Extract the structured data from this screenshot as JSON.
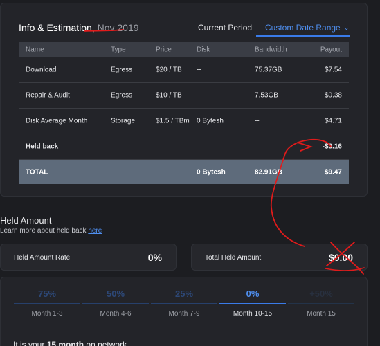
{
  "info": {
    "title": "Info & Estimation,",
    "period": "Nov 2019",
    "tabs": {
      "current": "Current Period",
      "custom": "Custom Date Range"
    },
    "table": {
      "headers": {
        "name": "Name",
        "type": "Type",
        "price": "Price",
        "disk": "Disk",
        "bandwidth": "Bandwidth",
        "payout": "Payout"
      },
      "rows": [
        {
          "name": "Download",
          "type": "Egress",
          "price": "$20 / TB",
          "disk": "--",
          "bandwidth": "75.37GB",
          "payout": "$7.54"
        },
        {
          "name": "Repair & Audit",
          "type": "Egress",
          "price": "$10 / TB",
          "disk": "--",
          "bandwidth": "7.53GB",
          "payout": "$0.38"
        },
        {
          "name": "Disk Average Month",
          "type": "Storage",
          "price": "$1.5 / TBm",
          "disk": "0 Bytesh",
          "bandwidth": "--",
          "payout": "$4.71"
        }
      ],
      "held_back": {
        "name": "Held back",
        "payout": "-$3.16"
      },
      "total": {
        "name": "TOTAL",
        "disk": "0 Bytesh",
        "bandwidth": "82.91GB",
        "payout": "$9.47"
      }
    }
  },
  "held": {
    "title": "Held Amount",
    "subtitle": "Learn more about held back",
    "link": "here",
    "rate_label": "Held Amount Rate",
    "rate_value": "0%",
    "total_label": "Total Held Amount",
    "total_value": "$0.00"
  },
  "months": [
    {
      "pct": "75%",
      "label": "Month 1-3"
    },
    {
      "pct": "50%",
      "label": "Month 4-6"
    },
    {
      "pct": "25%",
      "label": "Month 7-9"
    },
    {
      "pct": "0%",
      "label": "Month 10-15"
    },
    {
      "pct": "+50%",
      "label": "Month 15"
    }
  ],
  "network": {
    "prefix": "It is your",
    "month": "15 month",
    "suffix": "on network"
  },
  "colors": {
    "accent": "#3a7be8",
    "annotation": "#e01b1b",
    "total_row": "#5e6b7b"
  }
}
